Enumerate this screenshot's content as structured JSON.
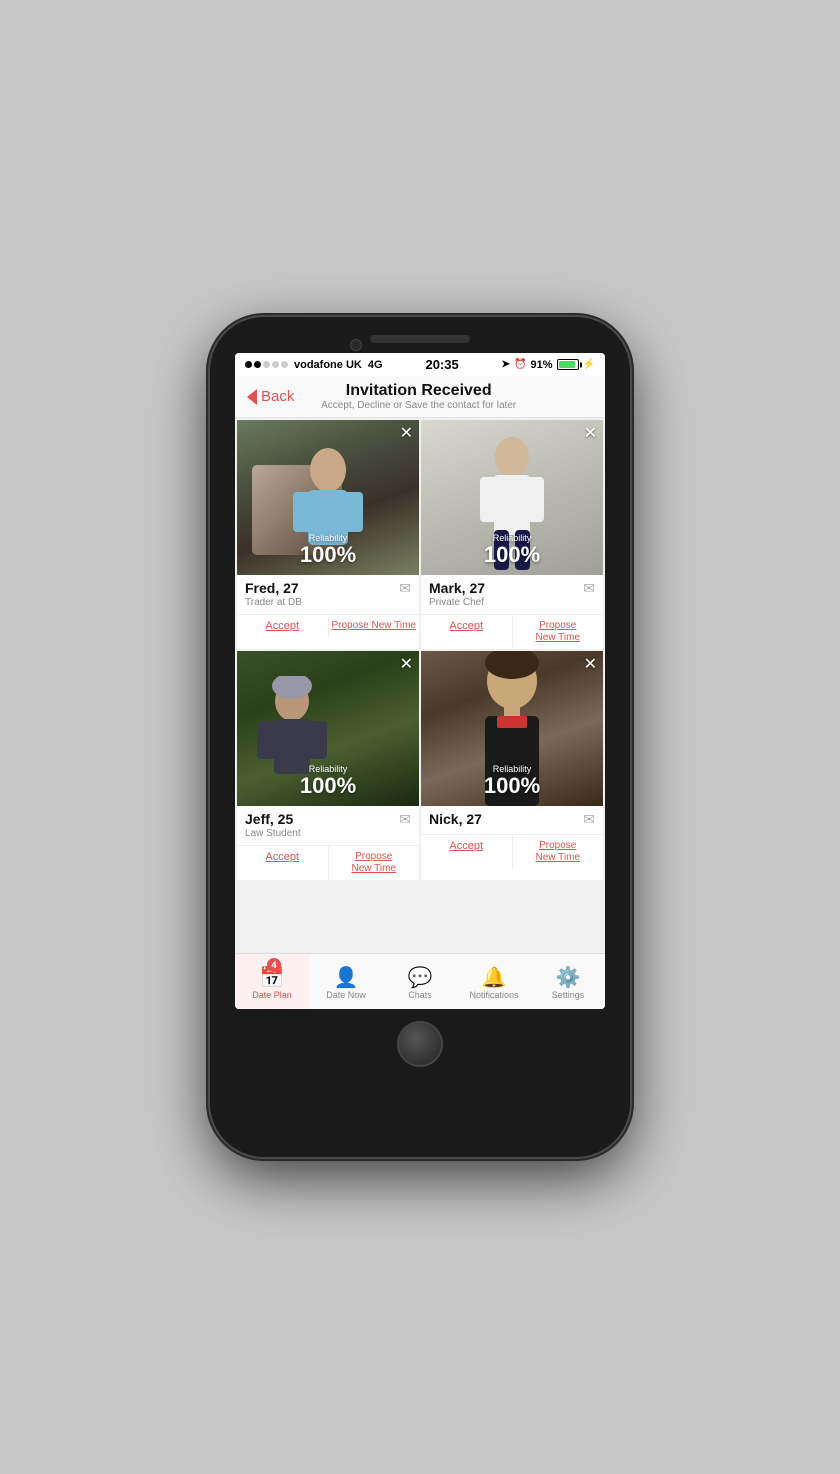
{
  "statusBar": {
    "carrier": "vodafone UK",
    "network": "4G",
    "time": "20:35",
    "battery": "91%",
    "signal_dots": [
      true,
      true,
      false,
      false,
      false
    ]
  },
  "header": {
    "back_label": "Back",
    "title": "Invitation Received",
    "subtitle": "Accept, Decline or Save the contact for later"
  },
  "cards": [
    {
      "id": "fred",
      "name": "Fred, 27",
      "job": "Trader at DB",
      "reliability": "100%",
      "reliability_label": "Reliability",
      "action1": "Accept",
      "action2": "Propose New Time",
      "photo_class": "photo-1"
    },
    {
      "id": "mark",
      "name": "Mark, 27",
      "job": "Private Chef",
      "reliability": "100%",
      "reliability_label": "Reliability",
      "action1": "Accept",
      "action2": "Propose New Time",
      "photo_class": "photo-2"
    },
    {
      "id": "jeff",
      "name": "Jeff, 25",
      "job": "Law Student",
      "reliability": "100%",
      "reliability_label": "Reliability",
      "action1": "Accept",
      "action2": "Propose New Time",
      "photo_class": "photo-3"
    },
    {
      "id": "nick",
      "name": "Nick, 27",
      "job": "",
      "reliability": "100%",
      "reliability_label": "Reliability",
      "action1": "Accept",
      "action2": "Propose New Time",
      "photo_class": "photo-4"
    }
  ],
  "tabs": [
    {
      "id": "date-plan",
      "label": "Date Plan",
      "icon": "📅",
      "active": true,
      "badge": "4"
    },
    {
      "id": "date-now",
      "label": "Date Now",
      "icon": "👤",
      "active": false,
      "badge": null
    },
    {
      "id": "chats",
      "label": "Chats",
      "icon": "💬",
      "active": false,
      "badge": null
    },
    {
      "id": "notifications",
      "label": "Notifications",
      "icon": "🔔",
      "active": false,
      "badge": null
    },
    {
      "id": "settings",
      "label": "Settings",
      "icon": "⚙️",
      "active": false,
      "badge": null
    }
  ]
}
